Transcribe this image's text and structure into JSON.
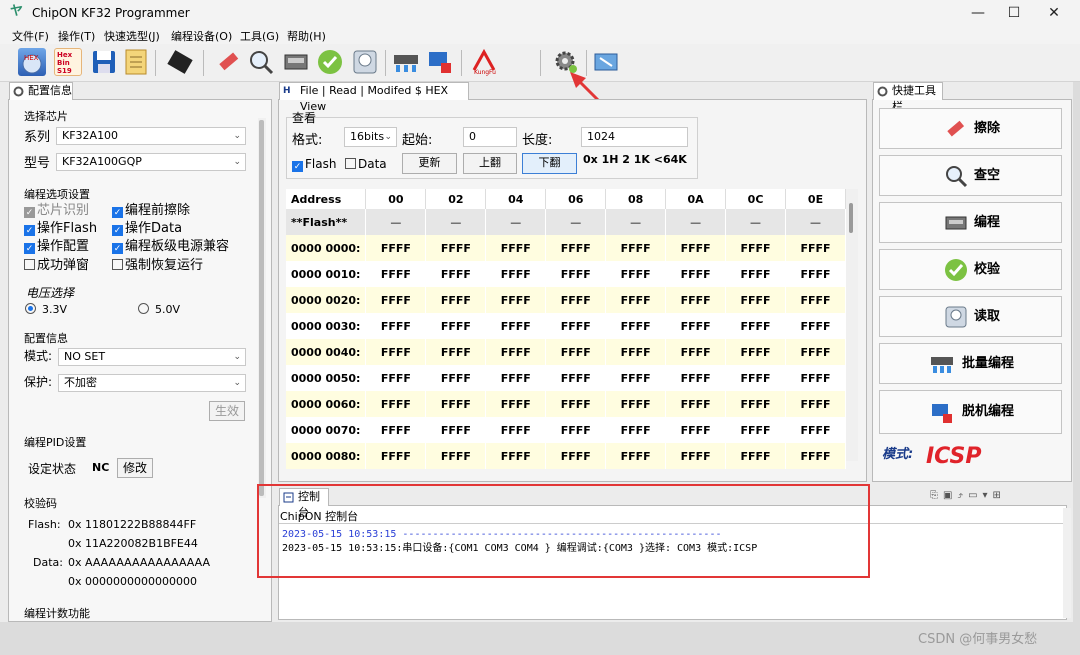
{
  "window": {
    "title": "ChipON KF32 Programmer",
    "controls": [
      "—",
      "☐",
      "✕"
    ]
  },
  "menu": [
    "文件(F)",
    "操作(T)",
    "快速选型(J)",
    "编程设备(O)",
    "工具(G)",
    "帮助(H)"
  ],
  "toolbar": {
    "icons": [
      "hex-file-icon",
      "hex-bin-s19-icon",
      "save-icon",
      "notes-icon",
      "chip-icon",
      "erase-icon",
      "check-empty-icon",
      "program-icon",
      "verify-icon",
      "read-icon",
      "batch-program-icon",
      "offline-program-icon",
      "kungfu-icon",
      "settings-gear-icon",
      "device-config-icon"
    ],
    "hexbin_label": "Hex Bin S19"
  },
  "left_panel": {
    "tab": "配置信息",
    "chip_section": "选择芯片",
    "series_label": "系列",
    "series_value": "KF32A100",
    "model_label": "型号",
    "model_value": "KF32A100GQP",
    "options_section": "编程选项设置",
    "options": [
      {
        "label": "芯片识别",
        "checked": true,
        "disabled": true
      },
      {
        "label": "编程前擦除",
        "checked": true,
        "disabled": false
      },
      {
        "label": "操作Flash",
        "checked": true,
        "disabled": false
      },
      {
        "label": "操作Data",
        "checked": true,
        "disabled": false
      },
      {
        "label": "操作配置",
        "checked": true,
        "disabled": false
      },
      {
        "label": "编程板级电源兼容",
        "checked": true,
        "disabled": false
      },
      {
        "label": "成功弹窗",
        "checked": false,
        "disabled": false
      },
      {
        "label": "强制恢复运行",
        "checked": false,
        "disabled": false
      }
    ],
    "voltage_section": "电压选择",
    "voltage_options": [
      "3.3V",
      "5.0V"
    ],
    "voltage_selected": "3.3V",
    "config_section": "配置信息",
    "mode_label": "模式:",
    "mode_value": "NO SET",
    "protect_label": "保护:",
    "protect_value": "不加密",
    "apply_button": "生效",
    "pid_section": "编程PID设置",
    "pid_state_label": "设定状态",
    "pid_state_value": "NC",
    "pid_modify_button": "修改",
    "checksum_section": "校验码",
    "flash_label": "Flash:",
    "flash_values": [
      "0x 11801222B88844FF",
      "0x 11A220082B1BFE44"
    ],
    "data_label": "Data:",
    "data_values": [
      "0x AAAAAAAAAAAAAAAA",
      "0x 0000000000000000"
    ],
    "count_section": "编程计数功能"
  },
  "hex_view": {
    "tab": "File | Read | Modifed $ HEX View",
    "group_label": "查看",
    "format_label": "格式:",
    "format_value": "16bits",
    "start_label": "起始:",
    "start_value": "0",
    "length_label": "长度:",
    "length_value": "1024",
    "flash_checkbox": "Flash",
    "data_checkbox": "Data",
    "refresh_button": "更新",
    "prev_button": "上翻",
    "next_button": "下翻",
    "range_info": "0x 1H 2 1K <64K",
    "columns": [
      "Address",
      "00",
      "02",
      "04",
      "06",
      "08",
      "0A",
      "0C",
      "0E"
    ],
    "flash_row": {
      "address": "**Flash**",
      "cells": [
        "—",
        "—",
        "—",
        "—",
        "—",
        "—",
        "—",
        "—"
      ]
    },
    "rows": [
      {
        "address": "0000 0000:",
        "cells": [
          "FFFF",
          "FFFF",
          "FFFF",
          "FFFF",
          "FFFF",
          "FFFF",
          "FFFF",
          "FFFF"
        ]
      },
      {
        "address": "0000 0010:",
        "cells": [
          "FFFF",
          "FFFF",
          "FFFF",
          "FFFF",
          "FFFF",
          "FFFF",
          "FFFF",
          "FFFF"
        ]
      },
      {
        "address": "0000 0020:",
        "cells": [
          "FFFF",
          "FFFF",
          "FFFF",
          "FFFF",
          "FFFF",
          "FFFF",
          "FFFF",
          "FFFF"
        ]
      },
      {
        "address": "0000 0030:",
        "cells": [
          "FFFF",
          "FFFF",
          "FFFF",
          "FFFF",
          "FFFF",
          "FFFF",
          "FFFF",
          "FFFF"
        ]
      },
      {
        "address": "0000 0040:",
        "cells": [
          "FFFF",
          "FFFF",
          "FFFF",
          "FFFF",
          "FFFF",
          "FFFF",
          "FFFF",
          "FFFF"
        ]
      },
      {
        "address": "0000 0050:",
        "cells": [
          "FFFF",
          "FFFF",
          "FFFF",
          "FFFF",
          "FFFF",
          "FFFF",
          "FFFF",
          "FFFF"
        ]
      },
      {
        "address": "0000 0060:",
        "cells": [
          "FFFF",
          "FFFF",
          "FFFF",
          "FFFF",
          "FFFF",
          "FFFF",
          "FFFF",
          "FFFF"
        ]
      },
      {
        "address": "0000 0070:",
        "cells": [
          "FFFF",
          "FFFF",
          "FFFF",
          "FFFF",
          "FFFF",
          "FFFF",
          "FFFF",
          "FFFF"
        ]
      },
      {
        "address": "0000 0080:",
        "cells": [
          "FFFF",
          "FFFF",
          "FFFF",
          "FFFF",
          "FFFF",
          "FFFF",
          "FFFF",
          "FFFF"
        ]
      }
    ]
  },
  "quick_toolbar": {
    "tab": "快捷工具栏",
    "buttons": [
      "擦除",
      "查空",
      "编程",
      "校验",
      "读取",
      "批量编程",
      "脱机编程"
    ],
    "mode_label": "模式:",
    "mode_value": "ICSP"
  },
  "console": {
    "tab": "控制台",
    "header": "ChipON 控制台",
    "lines": [
      "2023-05-15 10:53:15 -----------------------------------------------------",
      "2023-05-15 10:53:15:串口设备:{COM1 COM3 COM4 } 编程调试:{COM3 }选择: COM3 模式:ICSP"
    ]
  },
  "watermark": "CSDN @何事男女愁",
  "colors": {
    "accent_blue": "#1a73e8",
    "highlight_red": "#e23636",
    "row_yellow": "#fffde0",
    "mode_red": "#e0232a",
    "console_blue": "#2a3fd6"
  }
}
